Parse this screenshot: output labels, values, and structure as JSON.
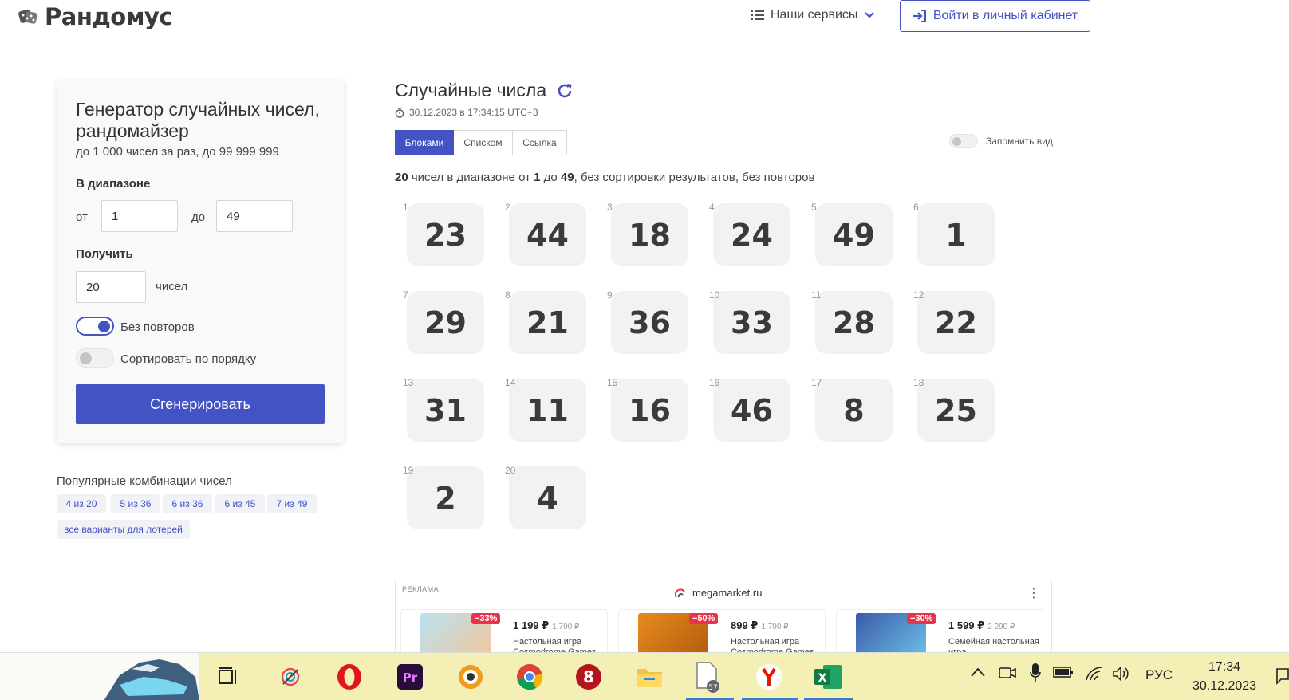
{
  "header": {
    "logo_text": "Рандомус",
    "services_label": "Наши сервисы",
    "login_label": "Войти в личный кабинет"
  },
  "generator": {
    "title": "Генератор случайных чисел, рандомайзер",
    "subtitle": "до 1 000 чисел за раз, до 99 999 999",
    "range_label": "В диапазоне",
    "from_label": "от",
    "from_value": "1",
    "to_label": "до",
    "to_value": "49",
    "get_label": "Получить",
    "count_value": "20",
    "count_unit": "чисел",
    "no_repeat_label": "Без повторов",
    "no_repeat_on": true,
    "sort_label": "Сортировать по порядку",
    "sort_on": false,
    "generate_label": "Сгенерировать"
  },
  "popular": {
    "title": "Популярные комбинации чисел",
    "chips": [
      "4 из 20",
      "5 из 36",
      "6 из 36",
      "6 из 45",
      "7 из 49"
    ],
    "all_label": "все варианты для лотерей"
  },
  "results": {
    "title": "Случайные числа",
    "timestamp": "30.12.2023 в 17:34:15 UTC+3",
    "tabs": [
      "Блоками",
      "Списком",
      "Ссылка"
    ],
    "active_tab": "Блоками",
    "remember_label": "Запомнить вид",
    "summary_count": "20",
    "summary_t1": "чисел в диапазоне от",
    "summary_from": "1",
    "summary_t2": "до",
    "summary_to": "49",
    "summary_t3": ", без сортировки результатов, без повторов",
    "numbers": [
      23,
      44,
      18,
      24,
      49,
      1,
      29,
      21,
      36,
      33,
      28,
      22,
      31,
      11,
      16,
      46,
      8,
      25,
      2,
      4
    ]
  },
  "ad": {
    "label": "РЕКЛАМА",
    "domain": "megamarket.ru",
    "cards": [
      {
        "discount": "−33%",
        "price": "1 199 ₽",
        "old_price": "1 790 ₽",
        "desc": "Настольная игра Cosmodrome Games"
      },
      {
        "discount": "−50%",
        "price": "899 ₽",
        "old_price": "1 790 ₽",
        "desc": "Настольная игра Cosmodrome Games"
      },
      {
        "discount": "−30%",
        "price": "1 599 ₽",
        "old_price": "2 290 ₽",
        "desc": "Семейная настольная игра"
      }
    ]
  },
  "taskbar": {
    "badge_count": "57",
    "lang": "РУС",
    "time": "17:34",
    "date": "30.12.2023"
  },
  "colors": {
    "accent": "#4353c4",
    "taskbar": "#f3efb5",
    "discount": "#e8334a"
  }
}
